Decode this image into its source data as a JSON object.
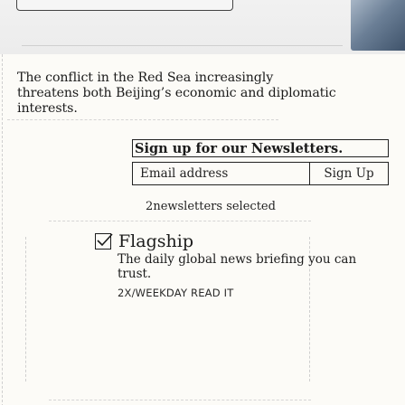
{
  "article": {
    "summary": "The conflict in the Red Sea increasingly threatens both Beijing’s economic and diplomatic interests."
  },
  "newsletter": {
    "title": "Sign up for our Newsletters.",
    "email_placeholder": "Email address",
    "signup_label": "Sign Up",
    "selected_count": "2newsletters selected",
    "items": [
      {
        "checked": true,
        "title": "Flagship",
        "description": "The daily global news briefing you can trust.",
        "meta": "2X/WEEKDAY   READ IT"
      }
    ]
  }
}
